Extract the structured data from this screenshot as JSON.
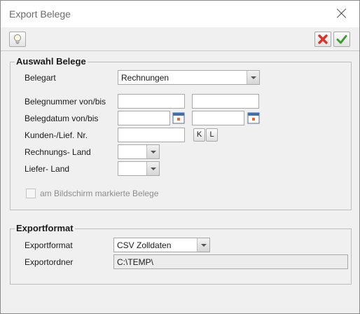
{
  "window": {
    "title": "Export Belege"
  },
  "toolbar": {
    "hint_icon": "lightbulb-icon",
    "cancel_icon": "red-x-icon",
    "ok_icon": "green-check-icon"
  },
  "auswahl": {
    "title": "Auswahl Belege",
    "belegart_label": "Belegart",
    "belegart_value": "Rechnungen",
    "belegnummer_label": "Belegnummer von/bis",
    "belegnummer_von": "",
    "belegnummer_bis": "",
    "belegdatum_label": "Belegdatum von/bis",
    "belegdatum_von": "",
    "belegdatum_bis": "",
    "kunden_label": "Kunden-/Lief. Nr.",
    "kunden_value": "",
    "k_button": "K",
    "l_button": "L",
    "rechnungsland_label": "Rechnungs- Land",
    "rechnungsland_value": "",
    "lieferland_label": "Liefer- Land",
    "lieferland_value": "",
    "markierte_label": "am Bildschirm markierte Belege"
  },
  "export": {
    "title": "Exportformat",
    "format_label": "Exportformat",
    "format_value": "CSV Zolldaten",
    "ordner_label": "Exportordner",
    "ordner_value": "C:\\TEMP\\"
  },
  "colors": {
    "cancel_red": "#d9332a",
    "ok_green": "#3c9a2e",
    "disabled_text": "#8c8c8c"
  }
}
